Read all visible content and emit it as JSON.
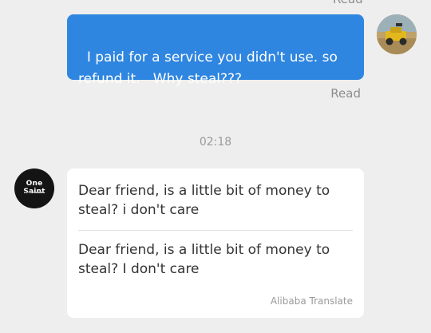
{
  "top_clip": {
    "read_label": "Read"
  },
  "outgoing_message": {
    "text": "I paid for a service you didn't use. so refund it.   Why steal???",
    "status": "Read"
  },
  "timestamp": "02:18",
  "incoming_message": {
    "avatar_brand": "One Saint",
    "original_text": "Dear friend, is a little bit of money to steal? i don't care",
    "translated_text": "Dear friend, is a little bit of money to steal? I don't care",
    "translation_credit": "Alibaba Translate"
  },
  "colors": {
    "background": "#eeeeee",
    "outgoing_bubble": "#2f86e0",
    "incoming_bubble": "#ffffff",
    "muted_text": "#8e8e8e"
  }
}
